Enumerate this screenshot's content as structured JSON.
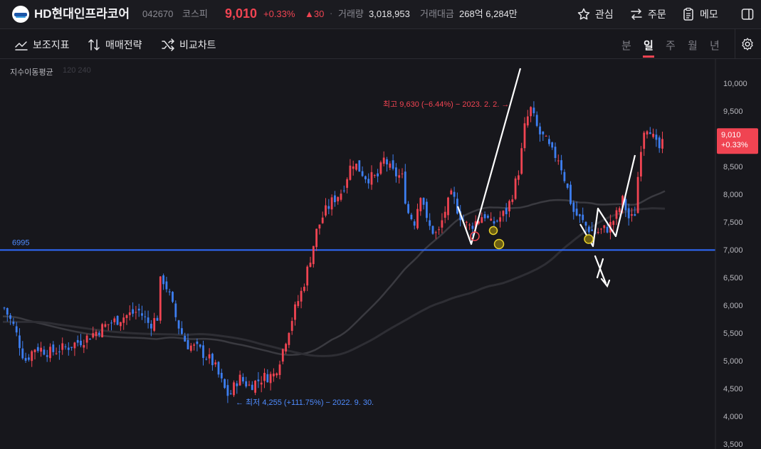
{
  "header": {
    "stock_name": "HD현대인프라코어",
    "code": "042670",
    "market": "코스피",
    "price": "9,010",
    "change_pct": "+0.33%",
    "change_value": "▲30",
    "separator": "·",
    "volume_label": "거래량",
    "volume_value": "3,018,953",
    "amount_label": "거래대금",
    "amount_value": "268억 6,284만",
    "actions": [
      {
        "label": "관심",
        "icon": "star-icon"
      },
      {
        "label": "주문",
        "icon": "swap-arrows-icon"
      },
      {
        "label": "메모",
        "icon": "memo-icon"
      }
    ]
  },
  "toolbar": {
    "indicators_label": "보조지표",
    "strategy_label": "매매전략",
    "compare_label": "비교차트",
    "periods": [
      "분",
      "일",
      "주",
      "월",
      "년"
    ],
    "active_period": "일"
  },
  "chart_data": {
    "type": "candlestick",
    "ma_label": "지수이동평균",
    "ma_periods": "120 240",
    "y_ticks": [
      "10,000",
      "9,500",
      "9,000",
      "8,500",
      "8,000",
      "7,500",
      "7,000",
      "6,500",
      "6,000",
      "5,500",
      "5,000",
      "4,500",
      "4,000",
      "3,500"
    ],
    "y_range": [
      3500,
      10000
    ],
    "current_price_label": "9,010",
    "current_change_label": "+0.33%",
    "current_price": 9010,
    "horizontal_line": {
      "label": "6995",
      "value": 6995
    },
    "high_annotation": "최고 9,630 (−6.44%) − 2023. 2. 2.",
    "low_annotation": "최저 4,255 (+111.75%) − 2022. 9. 30.",
    "high_value": 9630,
    "low_value": 4255,
    "colors": {
      "up": "#f04452",
      "down": "#3d7ef0",
      "ma": "#4a4a50",
      "hline": "#2f6bff"
    }
  }
}
